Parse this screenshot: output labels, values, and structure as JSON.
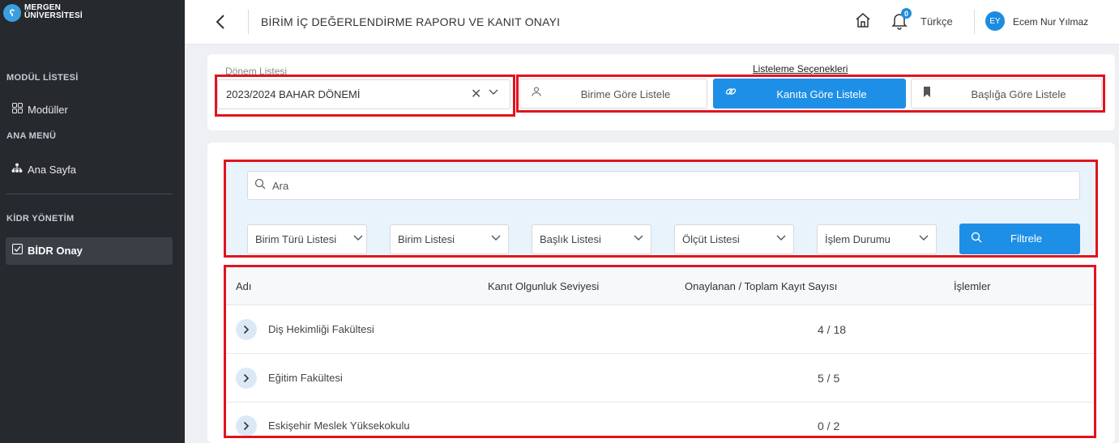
{
  "brand": {
    "line1": "MERGEN",
    "line2": "ÜNİVERSİTESİ"
  },
  "sidebar": {
    "module_section": "MODÜL LİSTESİ",
    "modules_label": "Modüller",
    "main_menu_section": "ANA MENÜ",
    "home_label": "Ana Sayfa",
    "kidr_section": "KİDR YÖNETİM",
    "bidr_label": "BİDR Onay"
  },
  "header": {
    "title": "BİRİM İÇ DEĞERLENDİRME RAPORU VE KANIT ONAYI",
    "notification_count": "0",
    "language": "Türkçe",
    "avatar_initials": "EY",
    "user_name": "Ecem Nur Yılmaz"
  },
  "period": {
    "label": "Dönem Listesi",
    "value": "2023/2024 BAHAR DÖNEMİ"
  },
  "list_options": {
    "label": "Listeleme Seçenekleri",
    "by_unit": "Birime Göre Listele",
    "by_evidence": "Kanıta Göre Listele",
    "by_title": "Başlığa Göre Listele",
    "active": "by_evidence"
  },
  "filters": {
    "search_placeholder": "Ara",
    "unit_type": "Birim Türü Listesi",
    "unit": "Birim Listesi",
    "title": "Başlık Listesi",
    "criterion": "Ölçüt Listesi",
    "status": "İşlem Durumu",
    "filter_button": "Filtrele"
  },
  "table": {
    "columns": [
      "Adı",
      "Kanıt Olgunluk Seviyesi",
      "Onaylanan / Toplam Kayıt Sayısı",
      "İşlemler"
    ],
    "rows": [
      {
        "name": "Diş Hekimliği Fakültesi",
        "count": "4 / 18"
      },
      {
        "name": "Eğitim Fakültesi",
        "count": "5 / 5"
      },
      {
        "name": "Eskişehir Meslek Yüksekokulu",
        "count": "0 / 2"
      }
    ]
  },
  "colors": {
    "accent": "#1e8fe6",
    "highlight": "#e0141e",
    "sidebar": "#26292e"
  }
}
